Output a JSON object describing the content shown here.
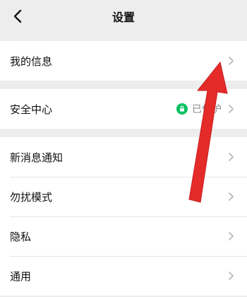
{
  "header": {
    "title": "设置",
    "back_icon": "chevron-left-icon"
  },
  "colors": {
    "background": "#ededed",
    "accent_green": "#07c160",
    "annotation_red": "#e52a2a"
  },
  "sections": [
    {
      "items": [
        {
          "label": "我的信息",
          "icon": "chevron-right-icon"
        }
      ]
    },
    {
      "items": [
        {
          "label": "安全中心",
          "status": "已保护",
          "status_icon": "lock-icon",
          "icon": "chevron-right-icon"
        }
      ]
    },
    {
      "items": [
        {
          "label": "新消息通知",
          "icon": "chevron-right-icon"
        },
        {
          "label": "勿扰模式",
          "icon": "chevron-right-icon"
        },
        {
          "label": "隐私",
          "icon": "chevron-right-icon"
        },
        {
          "label": "通用",
          "icon": "chevron-right-icon"
        }
      ]
    }
  ],
  "annotation": {
    "type": "arrow",
    "color": "#e52a2a"
  }
}
